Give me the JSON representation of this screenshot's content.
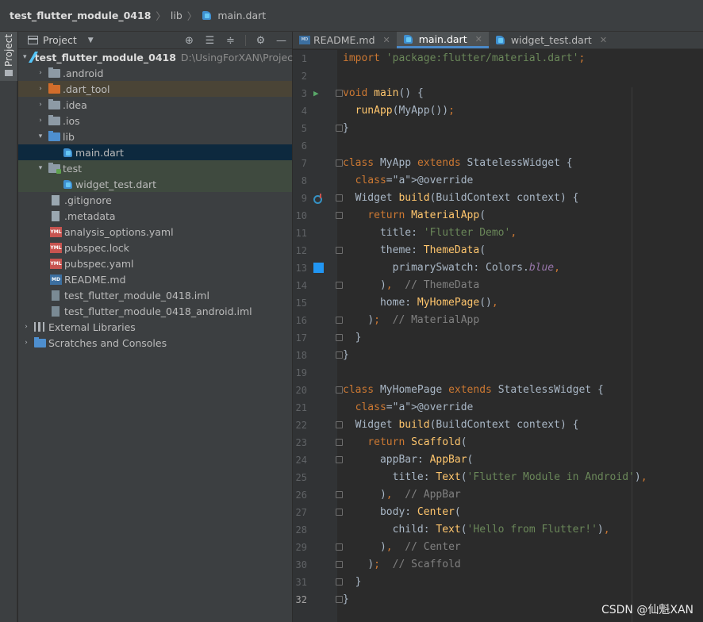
{
  "breadcrumb": {
    "root": "test_flutter_module_0418",
    "folder": "lib",
    "file": "main.dart"
  },
  "left_strip": {
    "label": "Project"
  },
  "project_panel": {
    "title": "Project",
    "tools": [
      "locate-icon",
      "expand-all-icon",
      "collapse-all-icon",
      "gear-icon",
      "minimize-icon"
    ],
    "tree": [
      {
        "label": "test_flutter_module_0418",
        "path": "D:\\UsingForXAN\\Projects",
        "icon": "flutter-icon",
        "arrow": "▾"
      },
      {
        "label": ".android",
        "icon": "folder-icon",
        "arrow": "›"
      },
      {
        "label": ".dart_tool",
        "icon": "folder-orange-icon",
        "arrow": "›"
      },
      {
        "label": ".idea",
        "icon": "folder-icon",
        "arrow": "›"
      },
      {
        "label": ".ios",
        "icon": "folder-icon",
        "arrow": "›"
      },
      {
        "label": "lib",
        "icon": "folder-blue-icon",
        "arrow": "▾"
      },
      {
        "label": "main.dart",
        "icon": "dart-file-icon",
        "arrow": ""
      },
      {
        "label": "test",
        "icon": "folder-test-icon",
        "arrow": "▾"
      },
      {
        "label": "widget_test.dart",
        "icon": "dart-file-icon",
        "arrow": ""
      },
      {
        "label": ".gitignore",
        "icon": "file-icon",
        "arrow": ""
      },
      {
        "label": ".metadata",
        "icon": "file-icon",
        "arrow": ""
      },
      {
        "label": "analysis_options.yaml",
        "icon": "yaml-icon",
        "arrow": ""
      },
      {
        "label": "pubspec.lock",
        "icon": "yaml-icon",
        "arrow": ""
      },
      {
        "label": "pubspec.yaml",
        "icon": "yaml-icon",
        "arrow": ""
      },
      {
        "label": "README.md",
        "icon": "md-icon",
        "arrow": ""
      },
      {
        "label": "test_flutter_module_0418.iml",
        "icon": "iml-file-icon",
        "arrow": ""
      },
      {
        "label": "test_flutter_module_0418_android.iml",
        "icon": "iml-file-icon",
        "arrow": ""
      },
      {
        "label": "External Libraries",
        "icon": "libraries-icon",
        "arrow": "›"
      },
      {
        "label": "Scratches and Consoles",
        "icon": "scratches-icon",
        "arrow": "›"
      }
    ]
  },
  "editor": {
    "tabs": [
      {
        "label": "README.md",
        "active": false
      },
      {
        "label": "main.dart",
        "active": true
      },
      {
        "label": "widget_test.dart",
        "active": false
      }
    ],
    "lines": [
      {
        "n": "1",
        "text": "import 'package:flutter/material.dart';"
      },
      {
        "n": "2",
        "text": ""
      },
      {
        "n": "3",
        "text": "void main() {"
      },
      {
        "n": "4",
        "text": "  runApp(MyApp());"
      },
      {
        "n": "5",
        "text": "}"
      },
      {
        "n": "6",
        "text": ""
      },
      {
        "n": "7",
        "text": "class MyApp extends StatelessWidget {"
      },
      {
        "n": "8",
        "text": "  @override"
      },
      {
        "n": "9",
        "text": "  Widget build(BuildContext context) {"
      },
      {
        "n": "10",
        "text": "    return MaterialApp("
      },
      {
        "n": "11",
        "text": "      title: 'Flutter Demo',"
      },
      {
        "n": "12",
        "text": "      theme: ThemeData("
      },
      {
        "n": "13",
        "text": "        primarySwatch: Colors.blue,"
      },
      {
        "n": "14",
        "text": "      ),  // ThemeData"
      },
      {
        "n": "15",
        "text": "      home: MyHomePage(),"
      },
      {
        "n": "16",
        "text": "    );  // MaterialApp"
      },
      {
        "n": "17",
        "text": "  }"
      },
      {
        "n": "18",
        "text": "}"
      },
      {
        "n": "19",
        "text": ""
      },
      {
        "n": "20",
        "text": "class MyHomePage extends StatelessWidget {"
      },
      {
        "n": "21",
        "text": "  @override"
      },
      {
        "n": "22",
        "text": "  Widget build(BuildContext context) {"
      },
      {
        "n": "23",
        "text": "    return Scaffold("
      },
      {
        "n": "24",
        "text": "      appBar: AppBar("
      },
      {
        "n": "25",
        "text": "        title: Text('Flutter Module in Android'),"
      },
      {
        "n": "26",
        "text": "      ),  // AppBar"
      },
      {
        "n": "27",
        "text": "      body: Center("
      },
      {
        "n": "28",
        "text": "        child: Text('Hello from Flutter!'),"
      },
      {
        "n": "29",
        "text": "      ),  // Center"
      },
      {
        "n": "30",
        "text": "    );  // Scaffold"
      },
      {
        "n": "31",
        "text": "  }"
      },
      {
        "n": "32",
        "text": "}"
      }
    ]
  },
  "watermark": "CSDN @仙魁XAN",
  "colors": {
    "keyword": "#cc7832",
    "string": "#6a8759",
    "function": "#ffc66d",
    "annotation": "#bbb529",
    "comment": "#808080",
    "field": "#9876aa",
    "swatch": "#2196f3"
  }
}
